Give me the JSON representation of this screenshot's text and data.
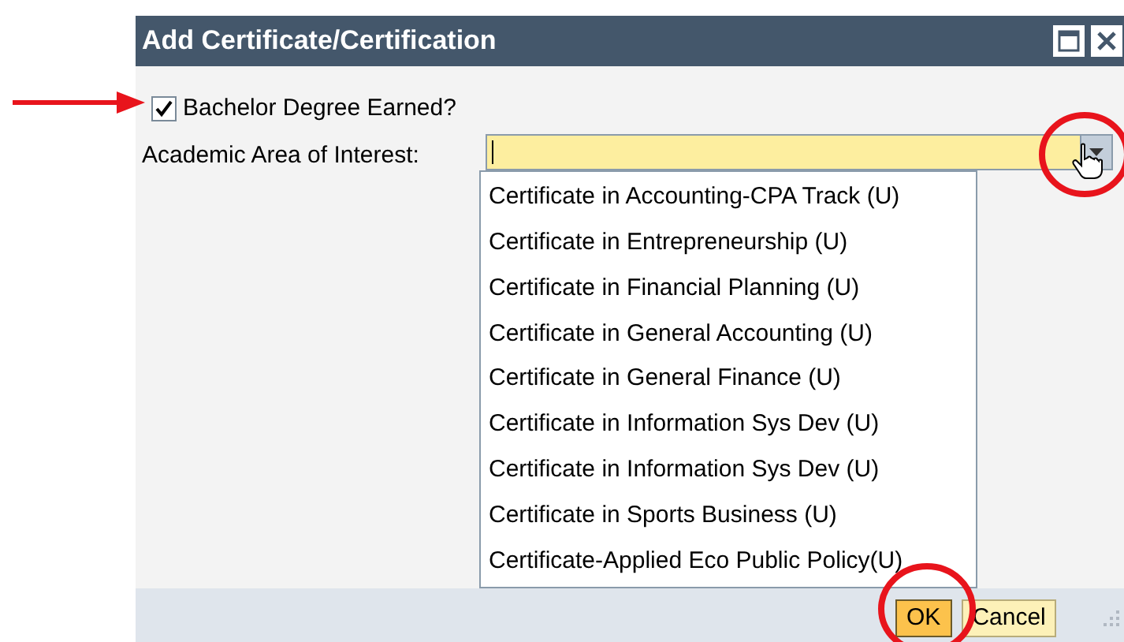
{
  "window": {
    "title": "Add Certificate/Certification"
  },
  "bachelor_checkbox": {
    "label": "Bachelor Degree Earned?",
    "checked": true
  },
  "academic_area": {
    "label": "Academic Area of Interest:",
    "expanded": true,
    "options": [
      "Certificate in Accounting-CPA Track (U)",
      "Certificate in Entrepreneurship (U)",
      "Certificate in Financial Planning (U)",
      "Certificate in General Accounting (U)",
      "Certificate in General Finance (U)",
      "Certificate in Information Sys Dev (U)",
      "Certificate in Information Sys Dev (U)",
      "Certificate in Sports Business (U)",
      "Certificate-Applied Eco Public Policy(U)"
    ]
  },
  "buttons": [
    {
      "label": "OK",
      "kind": "primary"
    },
    {
      "label": "Cancel",
      "kind": "secondary"
    }
  ]
}
